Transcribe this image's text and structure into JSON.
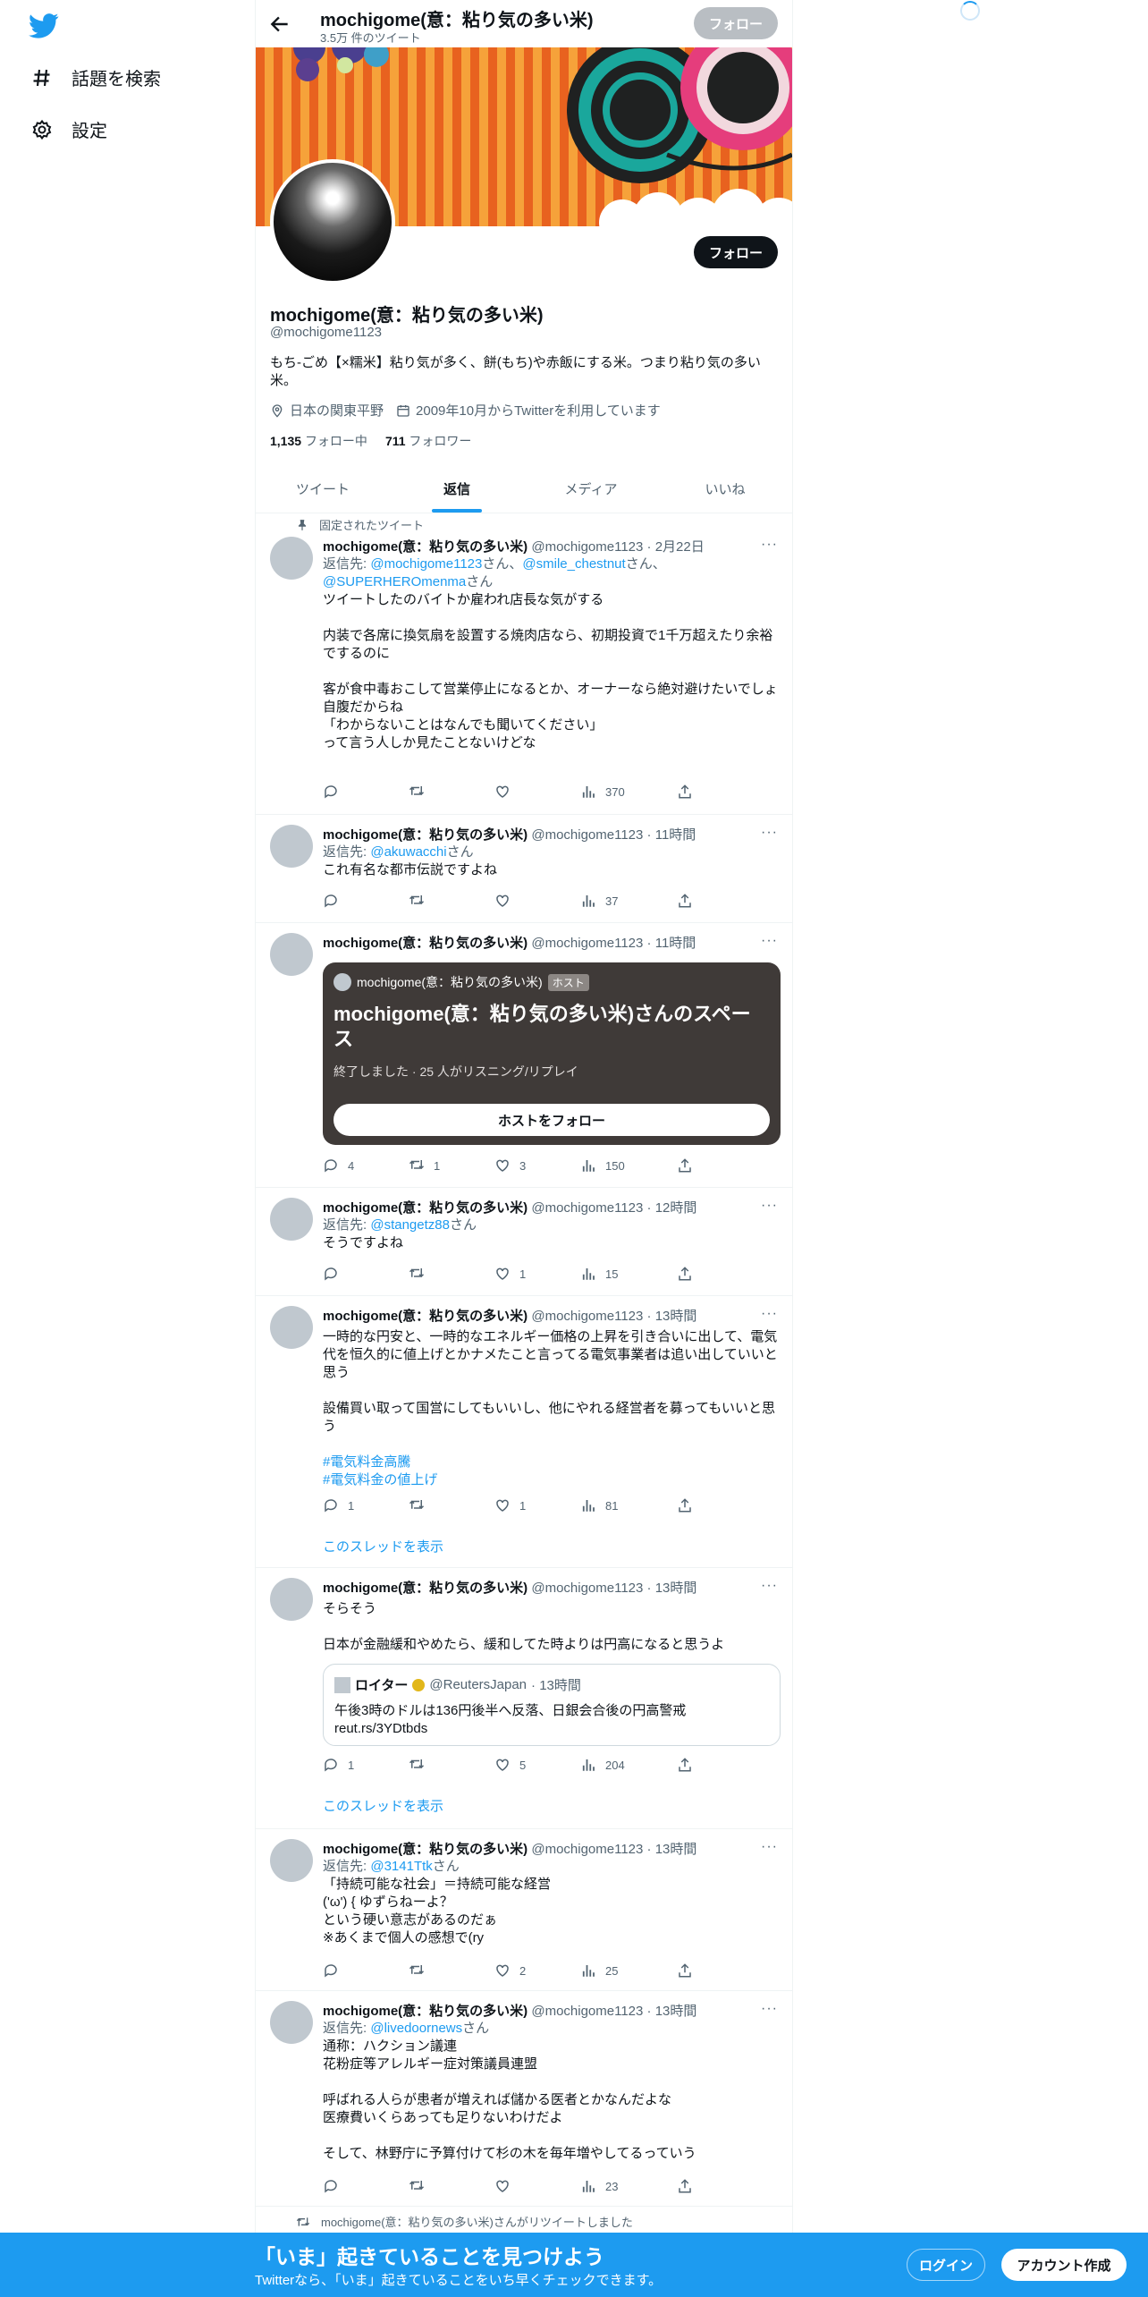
{
  "nav": {
    "explore_label": "話題を検索",
    "settings_label": "設定"
  },
  "header": {
    "name": "mochigome(意：粘り気の多い米)",
    "tweet_count": "3.5万 件のツイート",
    "follow_label": "フォロー"
  },
  "profile": {
    "name": "mochigome(意：粘り気の多い米)",
    "handle": "@mochigome1123",
    "bio": "もち-ごめ【×糯米】粘り気が多く、餅(もち)や赤飯にする米。つまり粘り気の多い米。",
    "location": "日本の関東平野",
    "joined": "2009年10月からTwitterを利用しています",
    "following_count": "1,135",
    "following_label": "フォロー中",
    "followers_count": "711",
    "followers_label": "フォロワー",
    "follow_label": "フォロー"
  },
  "tabs": [
    "ツイート",
    "返信",
    "メディア",
    "いいね"
  ],
  "pinned_label": "固定されたツイート",
  "author_name": "mochigome(意：粘り気の多い米)",
  "author_handle": "@mochigome1123",
  "more": "···",
  "reply_suffix": "さん",
  "reply_prefix": "返信先: ",
  "thread_label": "このスレッドを表示",
  "tweets": [
    {
      "time": "· 2月22日",
      "reply_to": [
        "@mochigome1123",
        "@smile_chestnut",
        "@SUPERHEROmenma"
      ],
      "text": "ツイートしたのバイトか雇われ店長な気がする\n\n内装で各席に換気扇を設置する焼肉店なら、初期投資で1千万超えたり余裕でするのに\n\n客が食中毒おこして営業停止になるとか、オーナーなら絶対避けたいでしょ\n自腹だからね\n「わからないことはなんでも聞いてください」\nって言う人しか見たことないけどな",
      "replies": "",
      "retweets": "",
      "likes": "",
      "views": "370"
    },
    {
      "time": "· 11時間",
      "reply_to": [
        "@akuwacchi"
      ],
      "text": "これ有名な都市伝説ですよね",
      "replies": "",
      "retweets": "",
      "likes": "",
      "views": "37"
    },
    {
      "time": "· 11時間",
      "text": "",
      "space": {
        "host": "mochigome(意：粘り気の多い米)",
        "badge": "ホスト",
        "title": "mochigome(意：粘り気の多い米)さんのスペース",
        "status": "終了しました · 25 人がリスニング/リプレイ",
        "button": "ホストをフォロー"
      },
      "replies": "4",
      "retweets": "1",
      "likes": "3",
      "views": "150"
    },
    {
      "time": "· 12時間",
      "reply_to": [
        "@stangetz88"
      ],
      "text": "そうですよね",
      "replies": "",
      "retweets": "",
      "likes": "1",
      "views": "15"
    },
    {
      "time": "· 13時間",
      "text": "一時的な円安と、一時的なエネルギー価格の上昇を引き合いに出して、電気代を恒久的に値上げとかナメたこと言ってる電気事業者は追い出していいと思う\n\n設備買い取って国営にしてもいいし、他にやれる経営者を募ってもいいと思う",
      "hashtags": [
        "#電気料金高騰",
        "#電気料金の値上げ"
      ],
      "replies": "1",
      "retweets": "",
      "likes": "1",
      "views": "81"
    },
    {
      "time": "· 13時間",
      "text": "そらそう\n\n日本が金融緩和やめたら、緩和してた時よりは円高になると思うよ",
      "quote": {
        "name": "ロイター",
        "handle": "@ReutersJapan",
        "time": "· 13時間",
        "text": "午後3時のドルは136円後半へ反落、日銀会合後の円高警戒\nreut.rs/3YDtbds"
      },
      "replies": "1",
      "retweets": "",
      "likes": "5",
      "views": "204"
    },
    {
      "time": "· 13時間",
      "reply_to": [
        "@3141Ttk"
      ],
      "text": "「持続可能な社会」＝持続可能な経営\n('ω') { ゆずらねーよ？\nという硬い意志があるのだぁ\n※あくまで個人の感想で(ry",
      "replies": "",
      "retweets": "",
      "likes": "2",
      "views": "25"
    },
    {
      "time": "· 13時間",
      "reply_to": [
        "@livedoornews"
      ],
      "text": "通称：ハクション議連\n花粉症等アレルギー症対策議員連盟\n\n呼ばれる人らが患者が増えれば儲かる医者とかなんだよな\n医療費いくらあっても足りないわけだよ\n\nそして、林野庁に予算付けて杉の木を毎年増やしてるっていう",
      "replies": "",
      "retweets": "",
      "likes": "",
      "views": "23"
    }
  ],
  "retweeted_note": "mochigome(意：粘り気の多い米)さんがリツイートしました",
  "bottom": {
    "title": "「いま」起きていることを見つけよう",
    "subtitle": "Twitterなら、「いま」起きていることをいち早くチェックできます。",
    "login": "ログイン",
    "signup": "アカウント作成"
  },
  "colors": {
    "accent": "#1d9bf0",
    "text": "#0f1419",
    "muted": "#536471",
    "space_card": "#3f3a38"
  },
  "icons": [
    "twitter-logo-icon",
    "hashtag-icon",
    "gear-icon",
    "back-arrow-icon",
    "location-icon",
    "calendar-icon",
    "pin-icon",
    "reply-icon",
    "retweet-icon",
    "like-icon",
    "views-icon",
    "share-icon"
  ]
}
